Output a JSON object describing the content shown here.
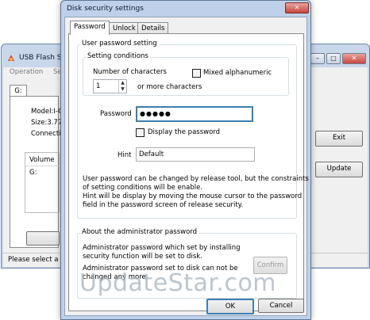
{
  "background_window": {
    "title": "USB Flash Se",
    "menu": [
      "Operation",
      "Se"
    ],
    "drive_tab": "G:",
    "info_lines": [
      "Model:I-O",
      "Size:3.77",
      "Connection"
    ],
    "volume_header": "Volume",
    "volume_row": "G:",
    "exit_label": "Exit",
    "update_label": "Update",
    "status_text": "Please select a d"
  },
  "dialog": {
    "title": "Disk security settings",
    "close_glyph": "✕",
    "tabs": [
      {
        "label": "Password",
        "active": true
      },
      {
        "label": "Unlock",
        "active": false
      },
      {
        "label": "Details",
        "active": false
      }
    ],
    "user_group": {
      "legend": "User password setting",
      "conditions_legend": "Setting conditions",
      "num_chars_label": "Number of characters",
      "num_chars_value": "1",
      "more_chars_label": "or more characters",
      "mixed_label": "Mixed alphanumeric",
      "mixed_checked": false,
      "password_label": "Password",
      "password_value": "●●●●●",
      "display_label": "Display the password",
      "display_checked": false,
      "hint_label": "Hint",
      "hint_value": "Default",
      "info_lines": [
        "User password can be changed by release tool, but the constraints",
        "of setting conditions will be enable.",
        "Hint will be display by moving the mouse cursor to the password",
        "field in the password screen of release security."
      ]
    },
    "admin_group": {
      "legend": "About the administrator password",
      "info_lines": [
        "Administrator password which set by installing",
        "security function will be set to disk.",
        "Administrator password set to disk can not be",
        "changed any more."
      ],
      "confirm_label": "Confirm"
    },
    "ok_label": "OK",
    "cancel_label": "Cancel"
  },
  "watermark": "UpdateStar.com",
  "icons": {
    "usb": "usb-icon",
    "close": "close-icon",
    "spin": "spin-arrows-icon"
  },
  "colors": {
    "title_bar": "#bfd1ea",
    "close_button": "#c9463d",
    "focus_border": "#3c7fb1"
  }
}
